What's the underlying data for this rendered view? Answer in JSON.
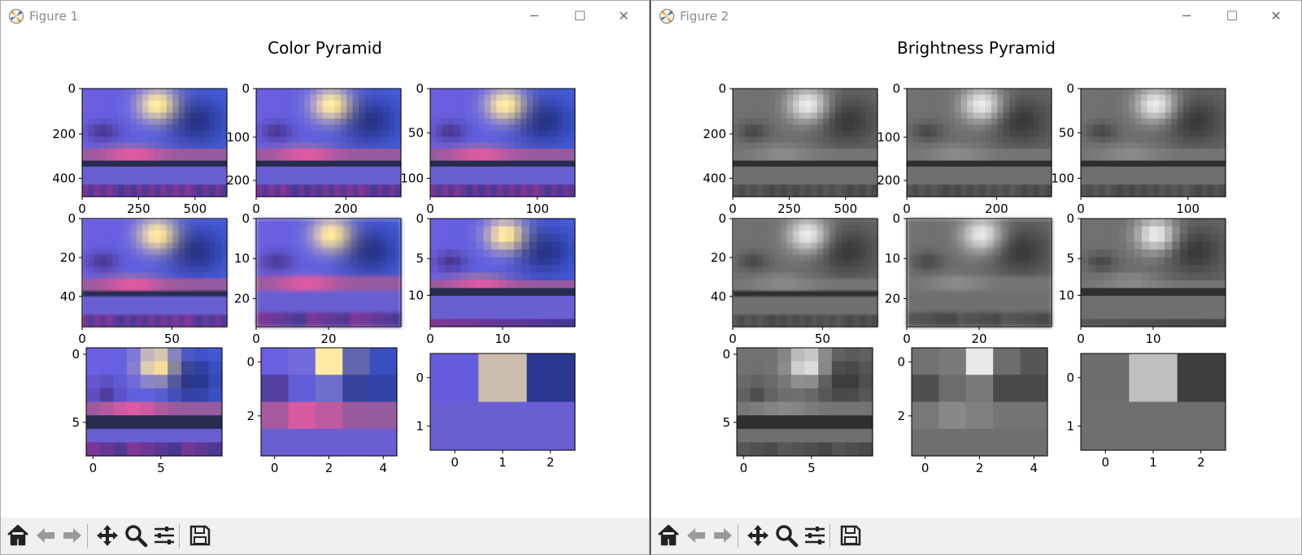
{
  "windows": [
    {
      "title": "Figure 1",
      "figure_title": "Color Pyramid",
      "mode": "color",
      "panels": [
        {
          "xticks": [
            "0",
            "250",
            "500"
          ],
          "yticks": [
            "0",
            "200",
            "400"
          ],
          "grid": [
            24,
            18
          ],
          "blur": 0
        },
        {
          "xticks": [
            "0",
            "200"
          ],
          "yticks": [
            "0",
            "100",
            "200"
          ],
          "grid": [
            24,
            18
          ],
          "blur": 0
        },
        {
          "xticks": [
            "0",
            "100"
          ],
          "yticks": [
            "0",
            "50",
            "100"
          ],
          "grid": [
            24,
            18
          ],
          "blur": 0
        },
        {
          "xticks": [
            "0",
            "50"
          ],
          "yticks": [
            "0",
            "20",
            "40"
          ],
          "grid": [
            24,
            18
          ],
          "blur": 1
        },
        {
          "xticks": [
            "0",
            "20"
          ],
          "yticks": [
            "0",
            "10",
            "20"
          ],
          "grid": [
            20,
            15
          ],
          "blur": 2
        },
        {
          "xticks": [
            "0",
            "10"
          ],
          "yticks": [
            "0",
            "5",
            "10"
          ],
          "grid": [
            19,
            14
          ],
          "blur": 0
        },
        {
          "xticks": [
            "0",
            "5"
          ],
          "yticks": [
            "0",
            "5"
          ],
          "grid": [
            10,
            8
          ],
          "blur": 0
        },
        {
          "xticks": [
            "0",
            "2",
            "4"
          ],
          "yticks": [
            "0",
            "2"
          ],
          "grid": [
            5,
            4
          ],
          "blur": 0
        },
        {
          "xticks": [
            "0",
            "1",
            "2"
          ],
          "yticks": [
            "0",
            "1"
          ],
          "grid": [
            3,
            2
          ],
          "blur": 0
        }
      ]
    },
    {
      "title": "Figure 2",
      "figure_title": "Brightness Pyramid",
      "mode": "gray",
      "panels": [
        {
          "xticks": [
            "0",
            "250",
            "500"
          ],
          "yticks": [
            "0",
            "200",
            "400"
          ],
          "grid": [
            24,
            18
          ],
          "blur": 0
        },
        {
          "xticks": [
            "0",
            "200"
          ],
          "yticks": [
            "0",
            "100",
            "200"
          ],
          "grid": [
            24,
            18
          ],
          "blur": 0
        },
        {
          "xticks": [
            "0",
            "100"
          ],
          "yticks": [
            "0",
            "50",
            "100"
          ],
          "grid": [
            24,
            18
          ],
          "blur": 0
        },
        {
          "xticks": [
            "0",
            "50"
          ],
          "yticks": [
            "0",
            "20",
            "40"
          ],
          "grid": [
            24,
            18
          ],
          "blur": 1
        },
        {
          "xticks": [
            "0",
            "20"
          ],
          "yticks": [
            "0",
            "10",
            "20"
          ],
          "grid": [
            20,
            15
          ],
          "blur": 2
        },
        {
          "xticks": [
            "0",
            "10"
          ],
          "yticks": [
            "0",
            "5",
            "10"
          ],
          "grid": [
            19,
            14
          ],
          "blur": 0
        },
        {
          "xticks": [
            "0",
            "5"
          ],
          "yticks": [
            "0",
            "5"
          ],
          "grid": [
            10,
            8
          ],
          "blur": 0
        },
        {
          "xticks": [
            "0",
            "2",
            "4"
          ],
          "yticks": [
            "0",
            "2"
          ],
          "grid": [
            5,
            4
          ],
          "blur": 0
        },
        {
          "xticks": [
            "0",
            "1",
            "2"
          ],
          "yticks": [
            "0",
            "1"
          ],
          "grid": [
            3,
            2
          ],
          "blur": 0
        }
      ]
    }
  ],
  "toolbar": {
    "icons": [
      "home-icon",
      "back-arrow-icon",
      "forward-arrow-icon",
      "pan-move-icon",
      "zoom-magnifier-icon",
      "configure-subplots-icon",
      "save-floppy-icon"
    ]
  },
  "window_controls": {
    "minimize": "─",
    "maximize": "☐",
    "close": "✕"
  }
}
